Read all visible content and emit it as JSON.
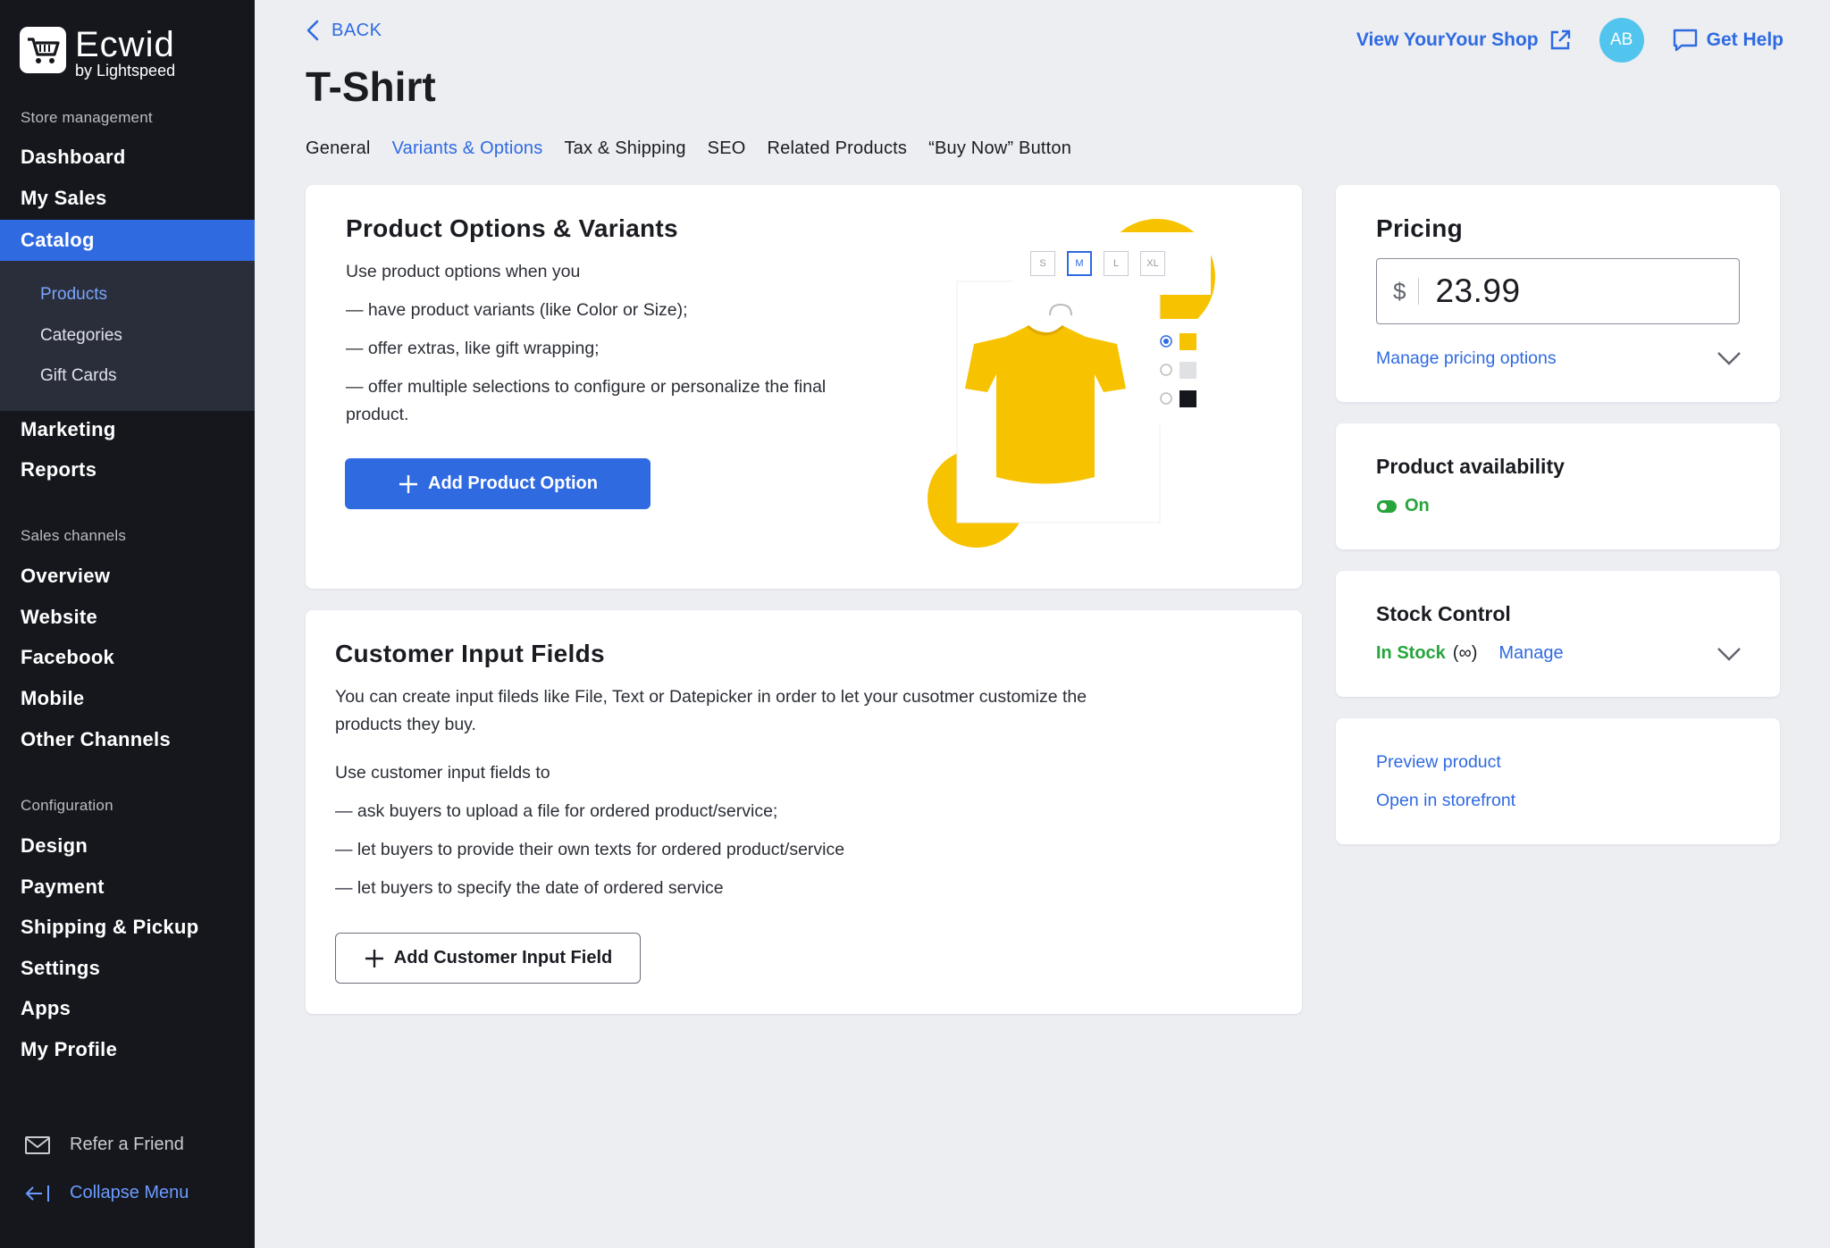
{
  "brand": {
    "name": "Ecwid",
    "sub": "by Lightspeed"
  },
  "sidebar": {
    "section_store": "Store management",
    "store_items": [
      "Dashboard",
      "My Sales",
      "Catalog"
    ],
    "catalog_sub": [
      "Products",
      "Categories",
      "Gift Cards"
    ],
    "store_items_after": [
      "Marketing",
      "Reports"
    ],
    "section_channels": "Sales channels",
    "channel_items": [
      "Overview",
      "Website",
      "Facebook",
      "Mobile",
      "Other Channels"
    ],
    "section_config": "Configuration",
    "config_items": [
      "Design",
      "Payment",
      "Shipping & Pickup",
      "Settings",
      "Apps",
      "My Profile"
    ],
    "refer": "Refer a Friend",
    "collapse": "Collapse Menu"
  },
  "header": {
    "back": "BACK",
    "title": "T-Shirt",
    "view_shop": "View YourYour Shop",
    "avatar_initials": "AB",
    "help": "Get Help"
  },
  "tabs": [
    "General",
    "Variants & Options",
    "Tax & Shipping",
    "SEO",
    "Related Products",
    "“Buy Now” Button"
  ],
  "options_card": {
    "title": "Product Options & Variants",
    "intro": "Use product options when you",
    "bullets": [
      "— have product variants (like Color or Size);",
      "— offer extras, like gift wrapping;",
      "— offer multiple selections to configure or personalize the final product."
    ],
    "button": "Add Product Option",
    "sizes": [
      "S",
      "M",
      "L",
      "XL"
    ]
  },
  "input_card": {
    "title": "Customer Input Fields",
    "desc": "You can create input fileds like File, Text or Datepicker in order to let your cusotmer customize the products they buy.",
    "intro": "Use customer input fields to",
    "bullets": [
      "— ask buyers to upload a file for ordered product/service;",
      "— let buyers to provide their own texts for ordered product/service",
      "— let buyers to specify the date of ordered service"
    ],
    "button": "Add Customer Input Field"
  },
  "pricing": {
    "title": "Pricing",
    "currency": "$",
    "price": "23.99",
    "manage": "Manage pricing options"
  },
  "availability": {
    "title": "Product availability",
    "status": "On"
  },
  "stock": {
    "title": "Stock Control",
    "status": "In Stock",
    "symbol": "(∞)",
    "manage": "Manage"
  },
  "links": {
    "preview": "Preview product",
    "storefront": "Open in storefront"
  },
  "colors": {
    "accent": "#2f6ae1",
    "sidebar": "#15171d",
    "success": "#27a53c",
    "yellow": "#f7c300"
  }
}
